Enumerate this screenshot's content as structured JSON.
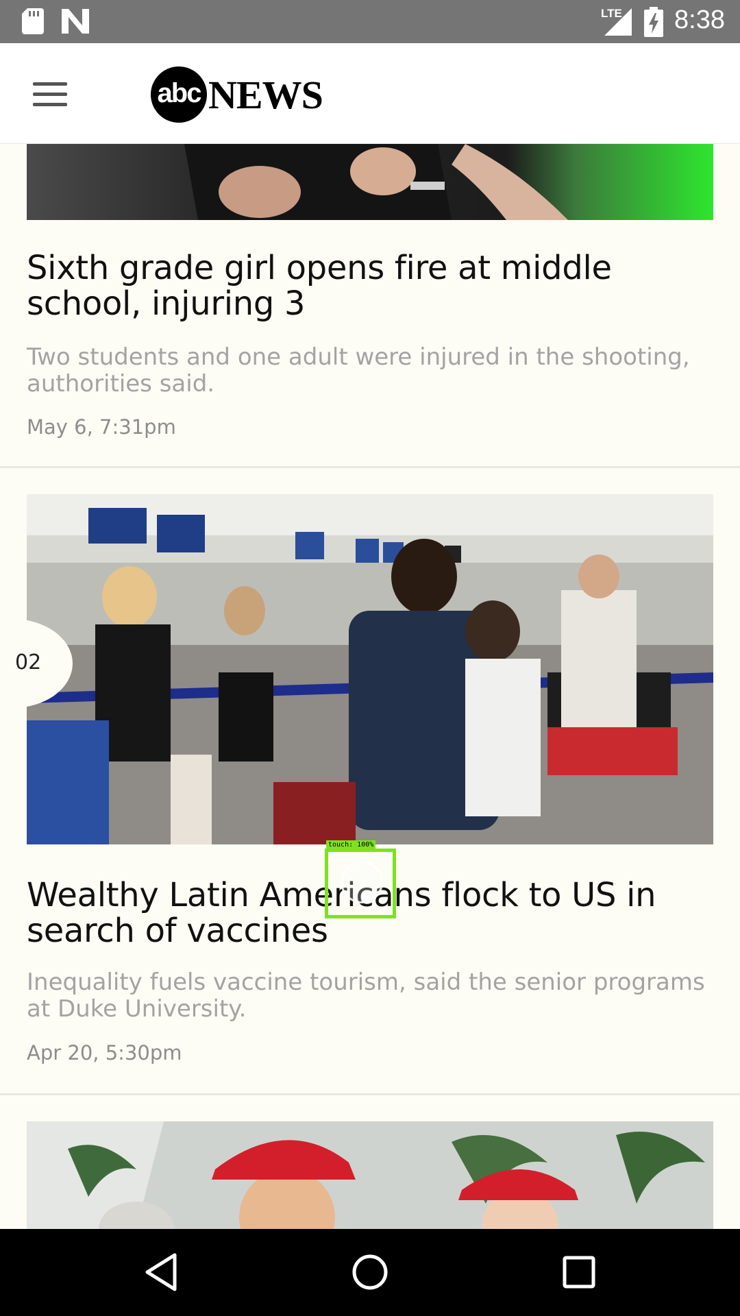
{
  "status_bar": {
    "time": "8:38",
    "network_label": "LTE",
    "icons": [
      "sd-card-icon",
      "n-notification-icon",
      "lte-signal-icon",
      "battery-charging-icon"
    ]
  },
  "header": {
    "menu_icon": "hamburger-menu-icon",
    "logo_circle_text": "abc",
    "logo_word": "NEWS"
  },
  "stories": [
    {
      "title": "Sixth grade girl opens fire at middle school, injuring 3",
      "summary": "Two students and one adult were injured in the shooting, authorities said.",
      "date": "May 6, 7:31pm"
    },
    {
      "rank": "02",
      "title": "Wealthy Latin Americans flock to US in search of vaccines",
      "summary": "Inequality fuels vaccine tourism, said the senior programs at Duke University.",
      "date": "Apr 20, 5:30pm"
    }
  ],
  "touch_overlay": {
    "label": "touch: 100%"
  },
  "nav_bar": {
    "icons": [
      "back-icon",
      "home-icon",
      "recents-icon"
    ]
  },
  "colors": {
    "status_bar": "#757575",
    "feed_background": "#fdfcf5",
    "title_text": "#111111",
    "summary_text": "#a3a3a3",
    "touch_highlight": "#7ee21e"
  }
}
